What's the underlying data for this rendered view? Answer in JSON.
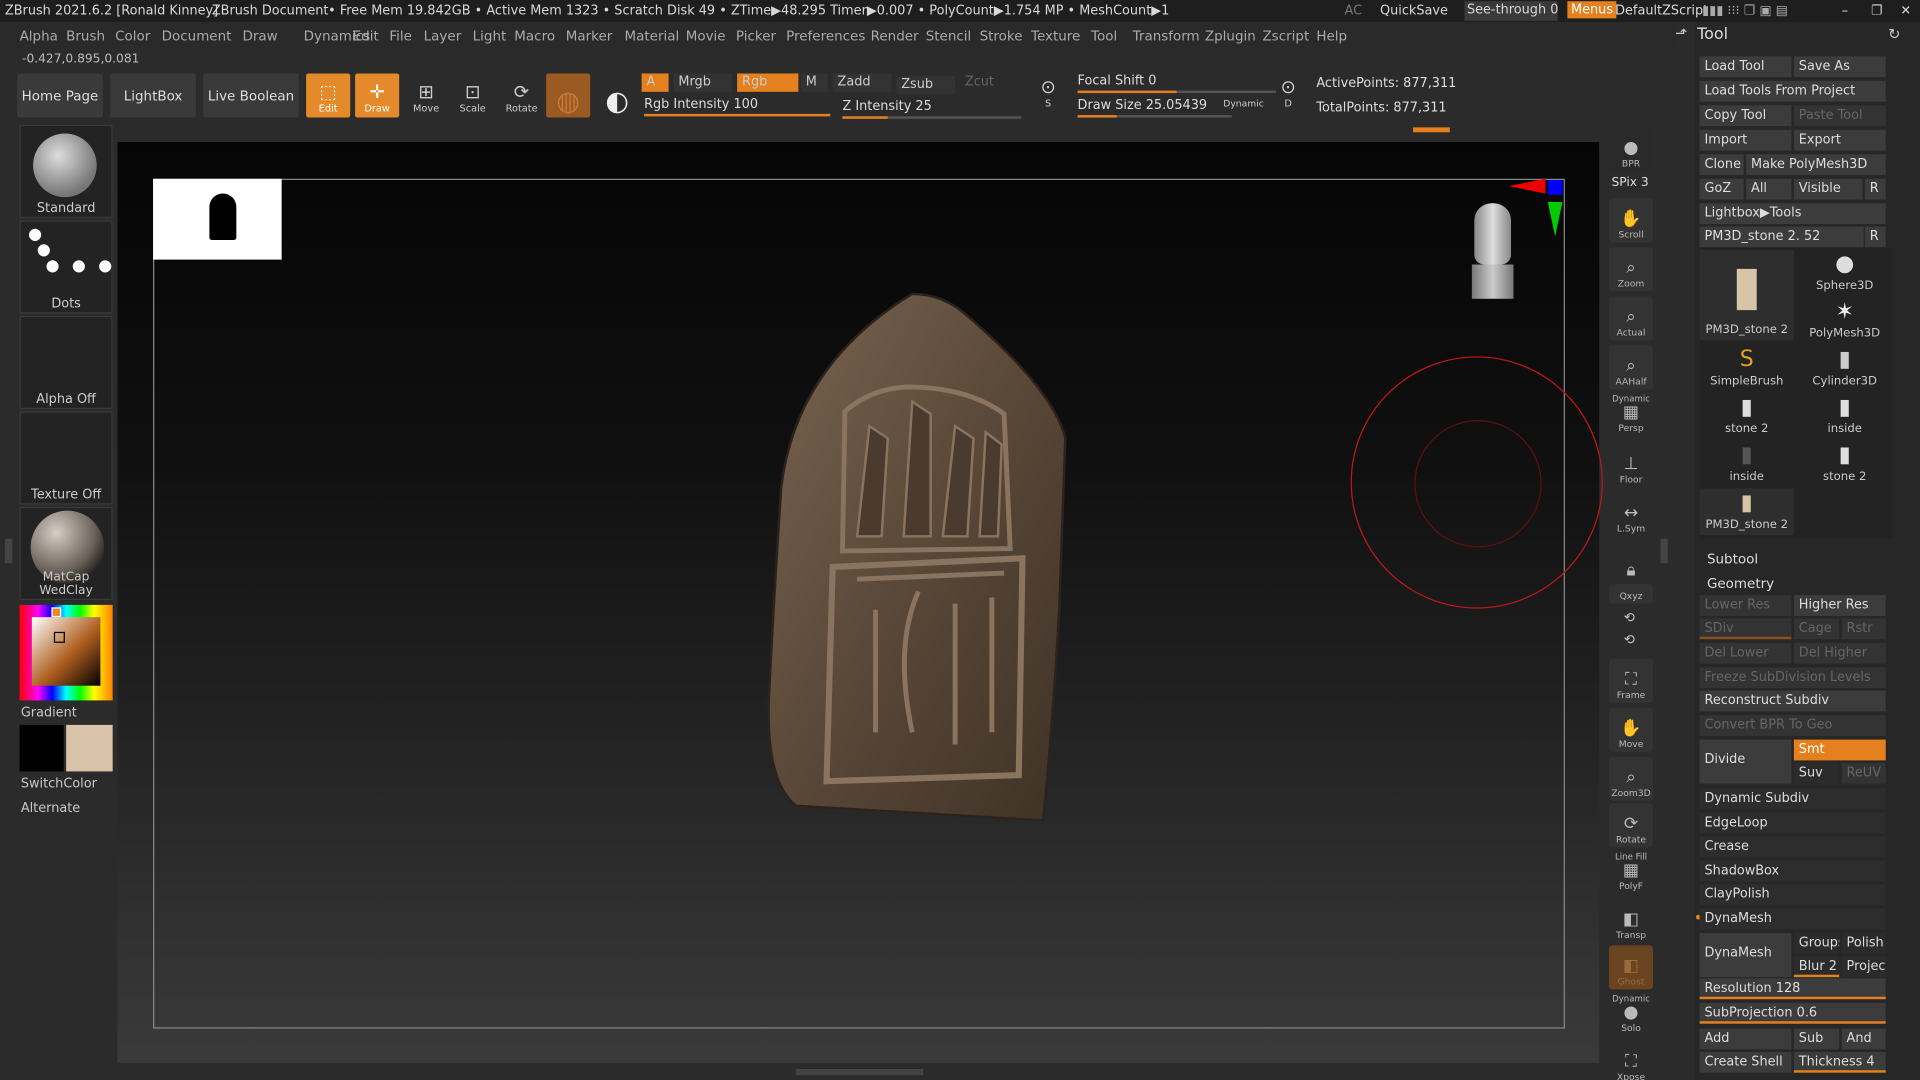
{
  "titlebar": {
    "app": "ZBrush 2021.6.2 [Ronald Kinney]",
    "doc": "ZBrush Document",
    "stats": "• Free Mem 19.842GB • Active Mem 1323 • Scratch Disk 49 • ZTime▶48.295 Timer▶0.007 • PolyCount▶1.754 MP • MeshCount▶1",
    "ac": "AC",
    "quicksave": "QuickSave",
    "seethrough": "See-through",
    "seethrough_val": "0",
    "menus": "Menus",
    "script": "DefaultZScript"
  },
  "menus": [
    "Alpha",
    "Brush",
    "Color",
    "Document",
    "Draw",
    "Dynamics",
    "Edit",
    "File",
    "Layer",
    "Light",
    "Macro",
    "Marker",
    "Material",
    "Movie",
    "Picker",
    "Preferences",
    "Render",
    "Stencil",
    "Stroke",
    "Texture",
    "Tool",
    "Transform",
    "Zplugin",
    "Zscript",
    "Help"
  ],
  "coords": "-0.427,0.895,0.081",
  "shelf": {
    "home": "Home Page",
    "lightbox": "LightBox",
    "liveboolean": "Live Boolean",
    "edit": "Edit",
    "draw": "Draw",
    "move": "Move",
    "scale": "Scale",
    "rotate": "Rotate"
  },
  "paint": {
    "a": "A",
    "mrgb": "Mrgb",
    "rgb": "Rgb",
    "m": "M",
    "zadd": "Zadd",
    "zsub": "Zsub",
    "zcut": "Zcut",
    "rgb_intensity": "Rgb Intensity 100",
    "z_intensity": "Z Intensity 25",
    "focal": "Focal Shift 0",
    "drawsize": "Draw Size 25.05439",
    "dynamic": "Dynamic",
    "active": "ActivePoints: 877,311",
    "total": "TotalPoints: 877,311"
  },
  "left": {
    "standard": "Standard",
    "dots": "Dots",
    "alpha": "Alpha Off",
    "texture": "Texture Off",
    "matcap": "MatCap WedClay",
    "gradient": "Gradient",
    "switchcolor": "SwitchColor",
    "alternate": "Alternate"
  },
  "right": {
    "bpr": "BPR",
    "spix": "SPix 3",
    "scroll": "Scroll",
    "zoom": "Zoom",
    "actual": "Actual",
    "aahalf": "AAHalf",
    "persp": "Persp",
    "dynamic": "Dynamic",
    "floor": "Floor",
    "lsym": "L.Sym",
    "xyz": "Qxyz",
    "frame": "Frame",
    "move": "Move",
    "zoom3d": "Zoom3D",
    "rotate": "Rotate",
    "linefill": "Line Fill",
    "polyf": "PolyF",
    "transp": "Transp",
    "ghost": "Ghost",
    "dynamic2": "Dynamic",
    "solo": "Solo",
    "xpose": "Xpose"
  },
  "panel": {
    "title": "Tool",
    "load": "Load Tool",
    "saveas": "Save As",
    "loadproj": "Load Tools From Project",
    "copy": "Copy Tool",
    "paste": "Paste Tool",
    "import": "Import",
    "export": "Export",
    "clone": "Clone",
    "makepoly": "Make PolyMesh3D",
    "goz": "GoZ",
    "all": "All",
    "visible": "Visible",
    "r": "R",
    "lightbox": "Lightbox▶Tools",
    "current": "PM3D_stone 2. 52",
    "tools": [
      "PM3D_stone 2",
      "Sphere3D",
      "SimpleBrush",
      "PolyMesh3D",
      "stone 2",
      "Cylinder3D",
      "inside",
      "inside",
      "stone 2",
      "PM3D_stone 2"
    ],
    "subtool": "Subtool",
    "geometry": "Geometry",
    "lower": "Lower Res",
    "higher": "Higher Res",
    "sdiv": "SDiv",
    "cage": "Cage",
    "rstr": "Rstr",
    "dellower": "Del Lower",
    "delhigher": "Del Higher",
    "freeze": "Freeze SubDivision Levels",
    "reconstruct": "Reconstruct Subdiv",
    "convert": "Convert BPR To Geo",
    "divide": "Divide",
    "smt": "Smt",
    "suv": "Suv",
    "reuv": "ReUV",
    "dynsub": "Dynamic Subdiv",
    "edgeloop": "EdgeLoop",
    "crease": "Crease",
    "shadowbox": "ShadowBox",
    "claypolish": "ClayPolish",
    "dynamesh": "DynaMesh",
    "dynamesh2": "DynaMesh",
    "groups": "Groups",
    "polish": "Polish",
    "blur": "Blur 2",
    "project": "Project",
    "resolution": "Resolution 128",
    "subproj": "SubProjection 0.6",
    "add": "Add",
    "sub": "Sub",
    "and": "And",
    "shell": "Create Shell",
    "thickness": "Thickness 4"
  }
}
